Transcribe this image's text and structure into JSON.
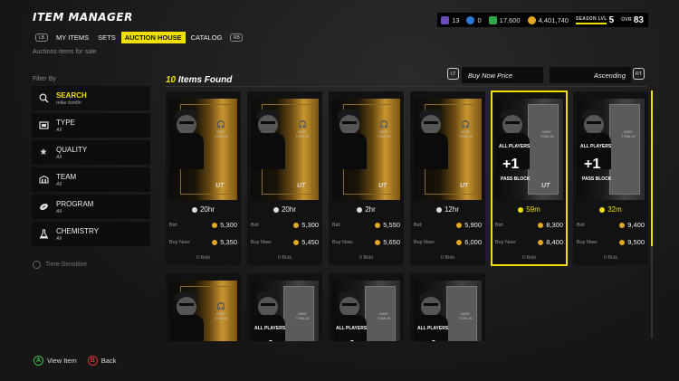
{
  "header": {
    "title": "ITEM MANAGER",
    "currency": {
      "training": "13",
      "points": "0",
      "tickets": "17,600",
      "coins": "4,401,740",
      "season_label": "SEASON LVL",
      "season_level": "5",
      "ovr_label": "OVR",
      "ovr_value": "83"
    }
  },
  "tabs": {
    "lb": "LB",
    "rb": "RB",
    "items": [
      "MY ITEMS",
      "SETS",
      "AUCTION HOUSE",
      "CATALOG"
    ],
    "active": "AUCTION HOUSE"
  },
  "subtitle": "Auctions items for sale",
  "filters": {
    "label": "Filter By",
    "items": [
      {
        "name": "SEARCH",
        "value": "mike tomlin",
        "icon": "search-icon"
      },
      {
        "name": "TYPE",
        "value": "All",
        "icon": "type-icon"
      },
      {
        "name": "QUALITY",
        "value": "All",
        "icon": "star-icon"
      },
      {
        "name": "TEAM",
        "value": "All",
        "icon": "stadium-icon"
      },
      {
        "name": "PROGRAM",
        "value": "All",
        "icon": "football-icon"
      },
      {
        "name": "CHEMISTRY",
        "value": "All",
        "icon": "flask-icon"
      }
    ],
    "time_sensitive": "Time-Sensitive"
  },
  "results": {
    "count": "10",
    "count_label": "Items Found"
  },
  "sort": {
    "lt": "LT",
    "field": "Buy Now Price",
    "direction": "Ascending",
    "rt": "RT"
  },
  "cards": [
    {
      "style": "gold",
      "timer": "20hr",
      "bid": "5,300",
      "buy_now": "5,350",
      "bids": "0 Bids",
      "name": "MIKE TOMLIN",
      "badge": "UT"
    },
    {
      "style": "gold",
      "timer": "20hr",
      "bid": "5,300",
      "buy_now": "5,450",
      "bids": "0 Bids",
      "name": "MIKE TOMLIN",
      "badge": "UT"
    },
    {
      "style": "gold",
      "timer": "2hr",
      "bid": "5,550",
      "buy_now": "5,650",
      "bids": "0 Bids",
      "name": "MIKE TOMLIN",
      "badge": "UT"
    },
    {
      "style": "gold",
      "timer": "12hr",
      "bid": "5,900",
      "buy_now": "6,000",
      "bids": "0 Bids",
      "name": "MIKE TOMLIN",
      "badge": "UT"
    },
    {
      "style": "silver",
      "timer": "59m",
      "bid": "8,300",
      "buy_now": "8,400",
      "bids": "0 Bids",
      "name": "MIKE TOMLIN",
      "badge": "UT",
      "ap": "ALL PLAYERS",
      "plus": "+1",
      "stat": "PASS BLOCK",
      "selected": true,
      "urgent": true
    },
    {
      "style": "silver",
      "timer": "32m",
      "bid": "9,400",
      "buy_now": "9,500",
      "bids": "0 Bids",
      "name": "MIKE TOMLIN",
      "badge": "",
      "ap": "ALL PLAYERS",
      "plus": "+1",
      "stat": "PASS BLOCK",
      "urgent": true
    }
  ],
  "cards_row2": [
    {
      "style": "gold",
      "name": "MIKE TOMLIN"
    },
    {
      "style": "silver",
      "name": "MIKE TOMLIN",
      "ap": "ALL PLAYERS",
      "plus": "+1"
    },
    {
      "style": "silver",
      "name": "MIKE TOMLIN",
      "ap": "ALL PLAYERS",
      "plus": "+1"
    },
    {
      "style": "silver",
      "name": "MIKE TOMLIN",
      "ap": "ALL PLAYERS",
      "plus": "+1"
    }
  ],
  "card_labels": {
    "bid": "Bid:",
    "buy_now": "Buy Now:"
  },
  "footer": {
    "a_key": "A",
    "a_label": "View Item",
    "b_key": "B",
    "b_label": "Back"
  },
  "colors": {
    "accent": "#f0e000",
    "coin": "#e0a820"
  }
}
